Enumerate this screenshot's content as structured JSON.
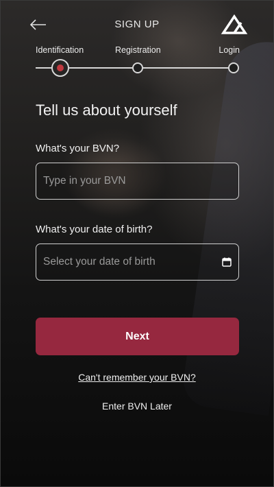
{
  "header": {
    "title": "SIGN UP",
    "back_icon": "arrow-left-icon",
    "logo_icon": "triangle-logo-icon"
  },
  "steps": [
    {
      "label": "Identification",
      "state": "active"
    },
    {
      "label": "Registration",
      "state": "pending"
    },
    {
      "label": "Login",
      "state": "pending"
    }
  ],
  "form": {
    "heading": "Tell us about yourself",
    "bvn": {
      "label": "What's your BVN?",
      "placeholder": "Type in your BVN",
      "value": ""
    },
    "dob": {
      "label": "What's your date of birth?",
      "placeholder": "Select your date of birth",
      "value": "",
      "icon": "calendar-icon"
    },
    "next_label": "Next",
    "forgot_link": "Can't remember your BVN?",
    "later_link": "Enter BVN Later"
  },
  "colors": {
    "accent": "#96283f",
    "active_step_dot": "#c0393f",
    "background": "#141414"
  }
}
